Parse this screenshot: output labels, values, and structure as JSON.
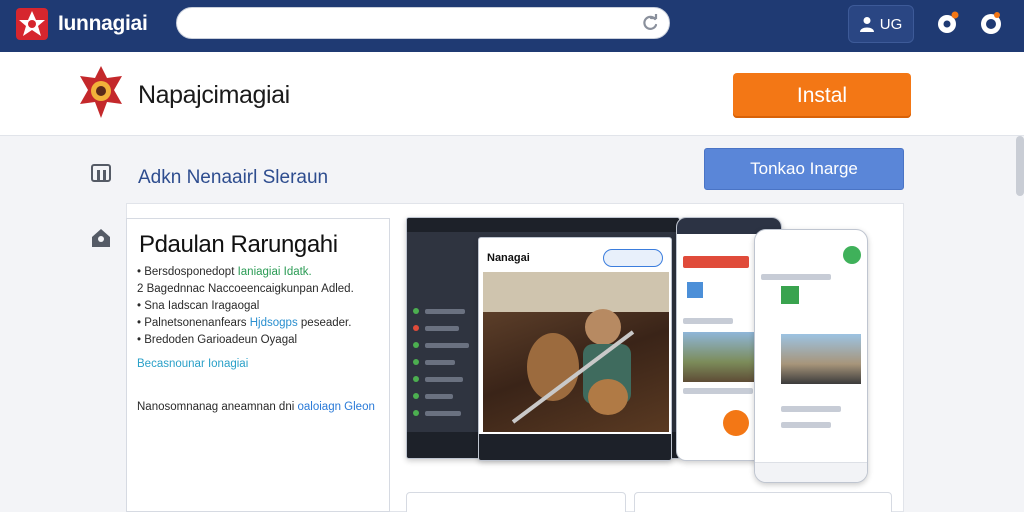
{
  "app": {
    "brand_name": "Iunnagiai",
    "login_label": "UG"
  },
  "header": {
    "app_title": "Napajcimagiai",
    "install_label": "Instal"
  },
  "section": {
    "title": "Adkn Nenaairl Sleraun",
    "secondary_button": "Tonkao Inarge"
  },
  "description": {
    "title": "Pdaulan Rarungahi",
    "items": [
      {
        "bullet": "•",
        "text": "Bersdosponedopt",
        "highlight": "Ianiagiai Idatk."
      },
      {
        "bullet": "2",
        "text": "Bagednnac Naccoeencaigkunpan Adled.",
        "highlight": ""
      },
      {
        "bullet": "•",
        "text": "Sna Iadscan Iragaogal",
        "highlight": ""
      },
      {
        "bullet": "•",
        "text": "Palnetsonenanfears",
        "highlight2": "Hjdsogps",
        "tail": "peseader."
      },
      {
        "bullet": "•",
        "text": "Bredoden Garioadeun Oyagal",
        "highlight": ""
      }
    ],
    "link": "Becasnounar Ionagiai",
    "note_prefix": "Nanosomnanag aneamnan dni",
    "note_highlight": "oaloiagn Gleon"
  },
  "screenshot": {
    "screen_title": "Nanagai"
  },
  "colors": {
    "topbar": "#1f3a73",
    "install": "#f37715",
    "secondary": "#5a86d8",
    "link": "#2aa0c8"
  },
  "icons": {
    "brand": "brand-logo-icon",
    "reload": "reload-icon",
    "user": "user-icon",
    "settings": "gear-icon",
    "chat": "chat-icon",
    "section": "device-icon",
    "description": "tag-icon"
  }
}
